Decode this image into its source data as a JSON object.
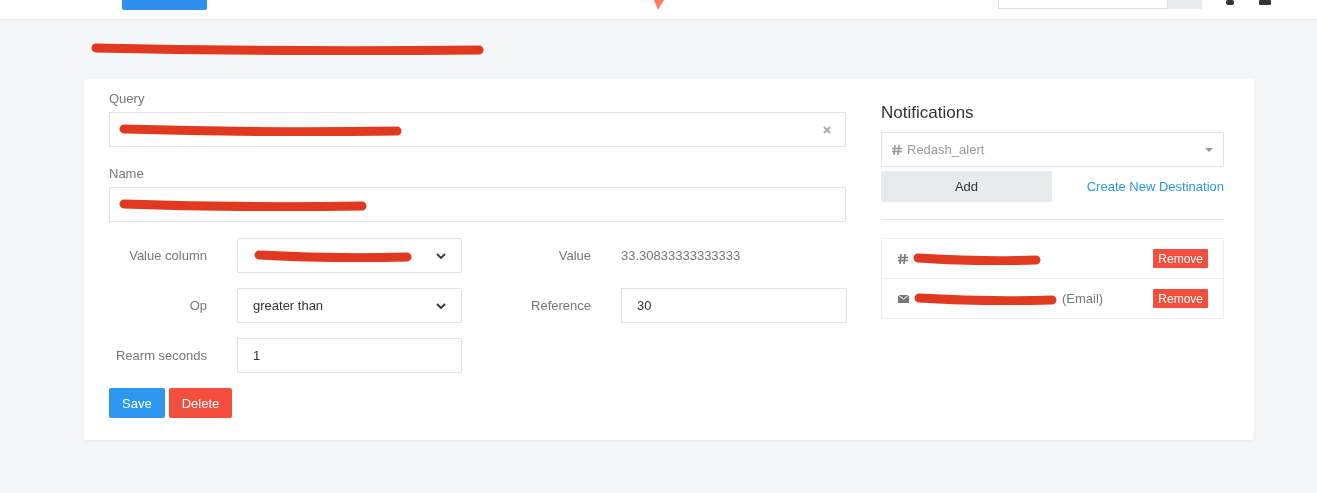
{
  "page_title": {
    "redacted": true
  },
  "query": {
    "label": "Query",
    "redacted": true
  },
  "name": {
    "label": "Name",
    "redacted": true
  },
  "value_column": {
    "label": "Value column",
    "redacted": true
  },
  "value": {
    "label": "Value",
    "text": "33.30833333333333"
  },
  "op": {
    "label": "Op",
    "value": "greater than"
  },
  "reference": {
    "label": "Reference",
    "value": "30"
  },
  "rearm": {
    "label": "Rearm seconds",
    "value": "1"
  },
  "buttons": [
    {
      "kind": "primary",
      "label": "Save"
    },
    {
      "kind": "danger",
      "label": "Delete"
    }
  ],
  "notifications": {
    "title": "Notifications",
    "destination": "Redash_alert",
    "add": "Add",
    "create_link": "Create New Destination",
    "items": [
      {
        "kind": "slack",
        "redacted": true,
        "remove": "Remove"
      },
      {
        "kind": "email",
        "redacted": true,
        "suffix": "(Email)",
        "remove": "Remove"
      }
    ]
  }
}
